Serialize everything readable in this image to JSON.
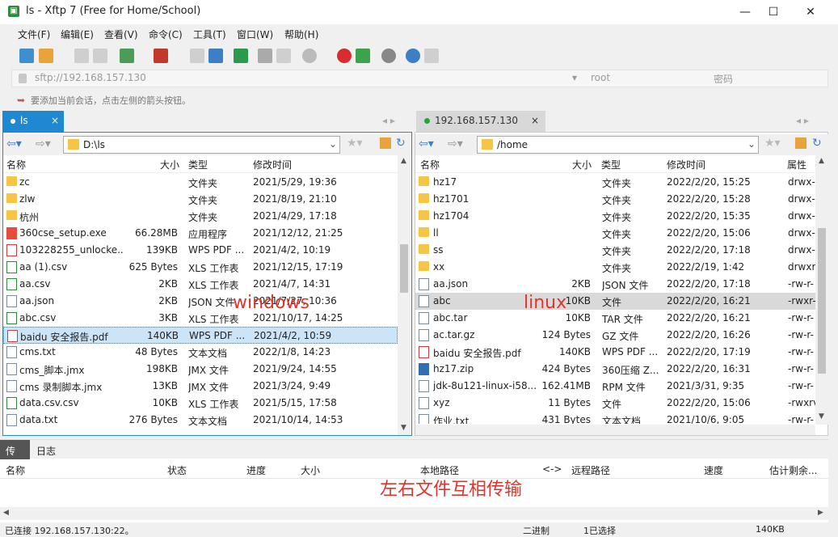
{
  "window": {
    "title": "ls - Xftp 7 (Free for Home/School)",
    "min": "—",
    "max": "☐",
    "close": "✕"
  },
  "menu": [
    "文件(F)",
    "编辑(E)",
    "查看(V)",
    "命令(C)",
    "工具(T)",
    "窗口(W)",
    "帮助(H)"
  ],
  "address": {
    "url": "sftp://192.168.157.130",
    "user_placeholder": "root",
    "password_placeholder": "密码"
  },
  "hint": "要添加当前会话，点击左侧的箭头按钮。",
  "left": {
    "tab": "ls",
    "path": "D:\\ls",
    "columns": [
      "名称",
      "大小",
      "类型",
      "修改时间"
    ],
    "overlay": "windows",
    "rows": [
      {
        "name": "zc",
        "size": "",
        "type": "文件夹",
        "date": "2021/5/29, 19:36",
        "icon": "folder"
      },
      {
        "name": "zlw",
        "size": "",
        "type": "文件夹",
        "date": "2021/8/19, 21:10",
        "icon": "folder"
      },
      {
        "name": "杭州",
        "size": "",
        "type": "文件夹",
        "date": "2021/4/29, 17:18",
        "icon": "folder"
      },
      {
        "name": "360cse_setup.exe",
        "size": "66.28MB",
        "type": "应用程序",
        "date": "2021/12/12, 21:25",
        "icon": "exe"
      },
      {
        "name": "103228255_unlocke...",
        "size": "139KB",
        "type": "WPS PDF ...",
        "date": "2021/4/2, 10:19",
        "icon": "pdf"
      },
      {
        "name": "aa (1).csv",
        "size": "625 Bytes",
        "type": "XLS 工作表",
        "date": "2021/12/15, 17:19",
        "icon": "xls"
      },
      {
        "name": "aa.csv",
        "size": "2KB",
        "type": "XLS 工作表",
        "date": "2021/4/7, 14:31",
        "icon": "xls"
      },
      {
        "name": "aa.json",
        "size": "2KB",
        "type": "JSON 文件",
        "date": "2021/7/27, 10:36",
        "icon": "doc"
      },
      {
        "name": "abc.csv",
        "size": "3KB",
        "type": "XLS 工作表",
        "date": "2021/10/17, 14:25",
        "icon": "xls"
      },
      {
        "name": "baidu 安全报告.pdf",
        "size": "140KB",
        "type": "WPS PDF ...",
        "date": "2021/4/2, 10:59",
        "icon": "pdf",
        "selected": true
      },
      {
        "name": "cms.txt",
        "size": "48 Bytes",
        "type": "文本文档",
        "date": "2022/1/8, 14:23",
        "icon": "doc"
      },
      {
        "name": "cms_脚本.jmx",
        "size": "198KB",
        "type": "JMX 文件",
        "date": "2021/9/24, 14:55",
        "icon": "doc"
      },
      {
        "name": "cms 录制脚本.jmx",
        "size": "13KB",
        "type": "JMX 文件",
        "date": "2021/3/24, 9:49",
        "icon": "doc"
      },
      {
        "name": "data.csv.csv",
        "size": "10KB",
        "type": "XLS 工作表",
        "date": "2021/5/15, 17:58",
        "icon": "xls"
      },
      {
        "name": "data.txt",
        "size": "276 Bytes",
        "type": "文本文档",
        "date": "2021/10/14, 14:53",
        "icon": "doc"
      }
    ]
  },
  "right": {
    "tab": "192.168.157.130",
    "path": "/home",
    "columns": [
      "名称",
      "大小",
      "类型",
      "修改时间",
      "属性"
    ],
    "overlay": "linux",
    "rows": [
      {
        "name": "hz17",
        "size": "",
        "type": "文件夹",
        "date": "2022/2/20, 15:25",
        "attr": "drwx-",
        "icon": "folder"
      },
      {
        "name": "hz1701",
        "size": "",
        "type": "文件夹",
        "date": "2022/2/20, 15:28",
        "attr": "drwx-",
        "icon": "folder"
      },
      {
        "name": "hz1704",
        "size": "",
        "type": "文件夹",
        "date": "2022/2/20, 15:35",
        "attr": "drwx-",
        "icon": "folder"
      },
      {
        "name": "ll",
        "size": "",
        "type": "文件夹",
        "date": "2022/2/20, 15:06",
        "attr": "drwx-",
        "icon": "folder"
      },
      {
        "name": "ss",
        "size": "",
        "type": "文件夹",
        "date": "2022/2/20, 17:18",
        "attr": "drwx-",
        "icon": "folder"
      },
      {
        "name": "xx",
        "size": "",
        "type": "文件夹",
        "date": "2022/2/19, 1:42",
        "attr": "drwxr",
        "icon": "folder"
      },
      {
        "name": "aa.json",
        "size": "2KB",
        "type": "JSON 文件",
        "date": "2022/2/20, 17:18",
        "attr": "-rw-r-",
        "icon": "doc"
      },
      {
        "name": "abc",
        "size": "10KB",
        "type": "文件",
        "date": "2022/2/20, 16:21",
        "attr": "-rwxr-",
        "icon": "doc",
        "selected": true
      },
      {
        "name": "abc.tar",
        "size": "10KB",
        "type": "TAR 文件",
        "date": "2022/2/20, 16:21",
        "attr": "-rw-r-",
        "icon": "doc"
      },
      {
        "name": "ac.tar.gz",
        "size": "124 Bytes",
        "type": "GZ 文件",
        "date": "2022/2/20, 16:26",
        "attr": "-rw-r-",
        "icon": "doc"
      },
      {
        "name": "baidu 安全报告.pdf",
        "size": "140KB",
        "type": "WPS PDF ...",
        "date": "2022/2/20, 17:19",
        "attr": "-rw-r-",
        "icon": "pdf"
      },
      {
        "name": "hz17.zip",
        "size": "424 Bytes",
        "type": "360压缩 Z...",
        "date": "2022/2/20, 16:31",
        "attr": "-rw-r-",
        "icon": "zip"
      },
      {
        "name": "jdk-8u121-linux-i58...",
        "size": "162.41MB",
        "type": "RPM 文件",
        "date": "2021/3/31, 9:35",
        "attr": "-rw-r-",
        "icon": "doc"
      },
      {
        "name": "xyz",
        "size": "11 Bytes",
        "type": "文件",
        "date": "2022/2/20, 15:06",
        "attr": "-rwxrv",
        "icon": "doc"
      },
      {
        "name": "作业.txt",
        "size": "431 Bytes",
        "type": "文本文档",
        "date": "2021/10/6, 9:05",
        "attr": "-rw-r-",
        "icon": "doc"
      }
    ]
  },
  "transfer": {
    "tabs": [
      "传输",
      "日志"
    ],
    "columns": [
      "名称",
      "状态",
      "进度",
      "大小",
      "本地路径",
      "<->",
      "远程路径",
      "速度",
      "估计剩余..."
    ],
    "overlay": "左右文件互相传输"
  },
  "status": {
    "left": "已连接 192.168.157.130:22。",
    "mode": "二进制",
    "selected": "1已选择",
    "size": "140KB"
  }
}
